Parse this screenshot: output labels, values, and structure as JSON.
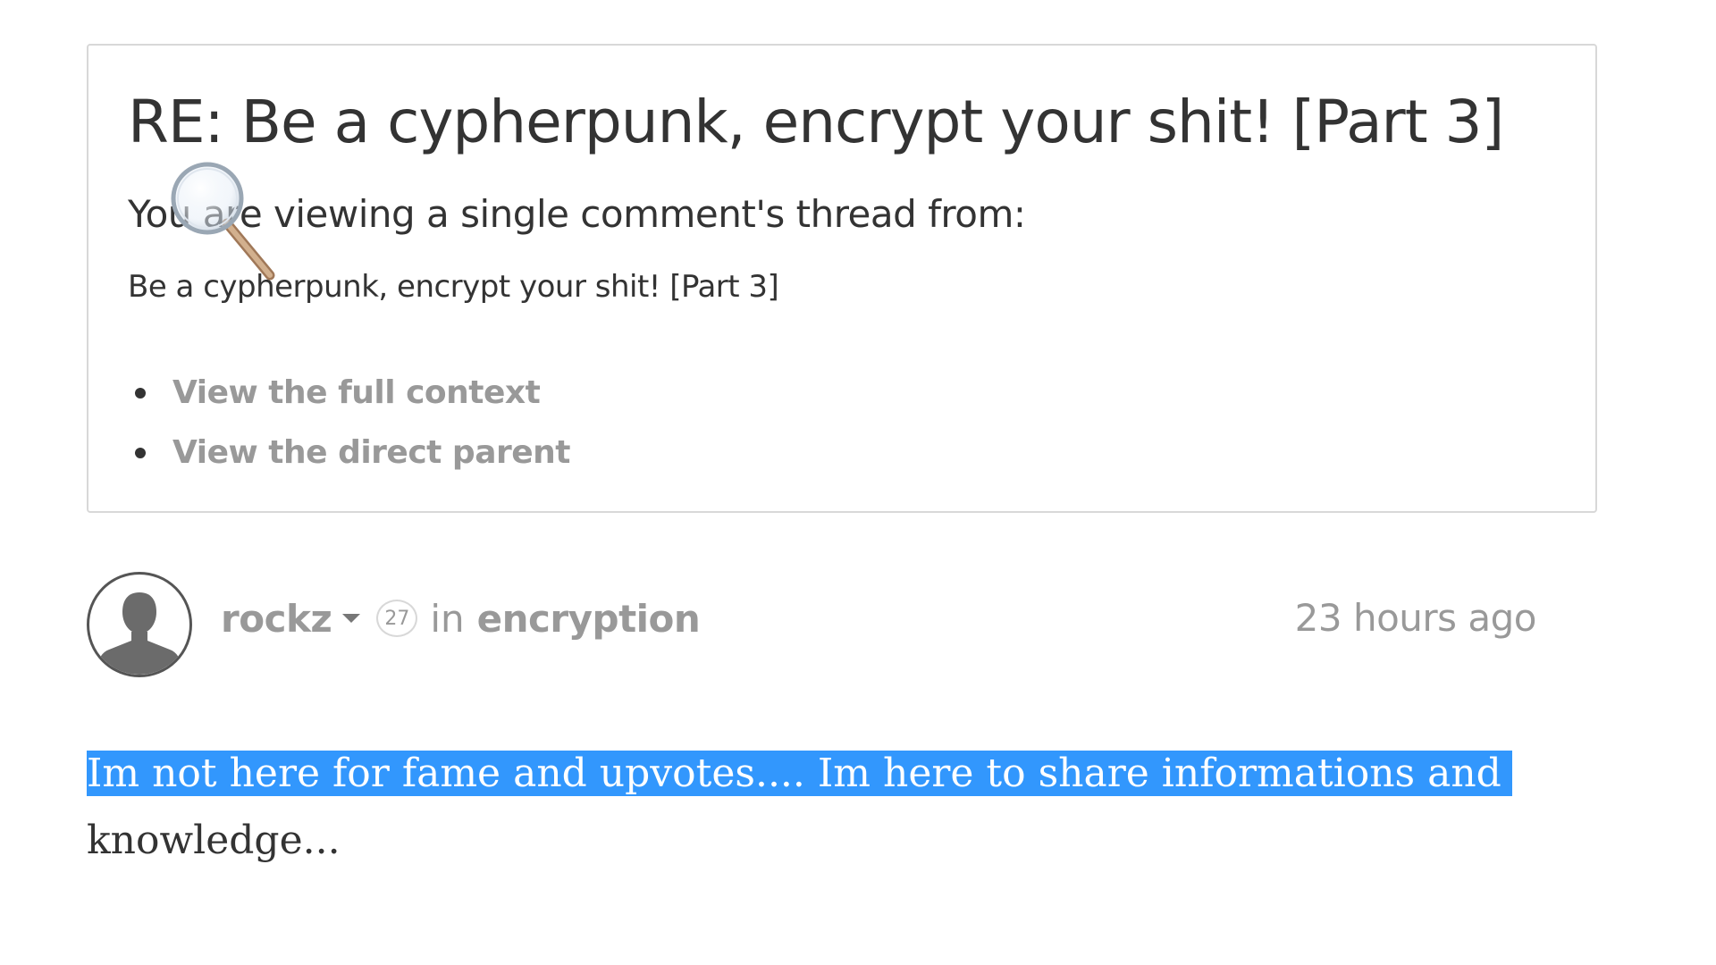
{
  "context": {
    "title": "RE: Be a cypherpunk, encrypt your shit! [Part 3]",
    "subtitle": "You are viewing a single comment's thread from:",
    "post_title": "Be a cypherpunk, encrypt your shit! [Part 3]",
    "links": [
      {
        "label": "View the full context"
      },
      {
        "label": "View the direct parent"
      }
    ]
  },
  "comment": {
    "author": "rockz",
    "reputation": "27",
    "in_label": "in",
    "category": "encryption",
    "timestamp": "23 hours ago",
    "body_highlighted": "Im not here for fame and upvotes.... Im here to share informations and",
    "body_rest": "knowledge..."
  },
  "icons": {
    "avatar": "default-user-avatar-icon",
    "caret": "caret-down-icon",
    "cursor": "magnifier-cursor-icon"
  },
  "colors": {
    "selection": "#3297fd",
    "muted_text": "#999999",
    "body_text": "#333333",
    "border": "#d8d8d8"
  }
}
